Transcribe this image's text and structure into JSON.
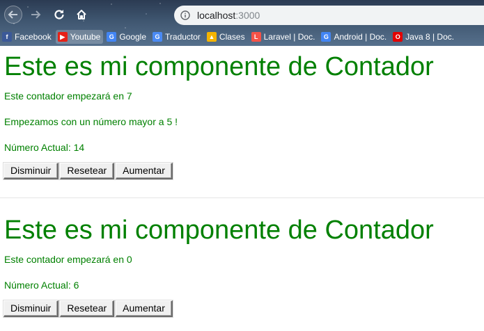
{
  "browser": {
    "url_host": "localhost",
    "url_port": ":3000",
    "bookmarks": [
      {
        "label": "Facebook",
        "icon": "facebook-icon",
        "color": "#3b5998",
        "glyph": "f"
      },
      {
        "label": "Youtube",
        "icon": "youtube-icon",
        "color": "#e62117",
        "glyph": "▶",
        "active": true
      },
      {
        "label": "Google",
        "icon": "google-icon",
        "color": "#4285f4",
        "glyph": "G"
      },
      {
        "label": "Traductor",
        "icon": "translate-icon",
        "color": "#4a8af4",
        "glyph": "G"
      },
      {
        "label": "Clases",
        "icon": "classroom-icon",
        "color": "#f4b400",
        "glyph": "▲"
      },
      {
        "label": "Laravel | Doc.",
        "icon": "laravel-icon",
        "color": "#f55247",
        "glyph": "L"
      },
      {
        "label": "Android | Doc.",
        "icon": "google-icon",
        "color": "#4285f4",
        "glyph": "G"
      },
      {
        "label": "Java 8 | Doc.",
        "icon": "oracle-icon",
        "color": "#e30000",
        "glyph": "O"
      }
    ]
  },
  "counters": [
    {
      "title": "Este es mi componente de Contador",
      "start_text": "Este contador empezará en 7",
      "extra_text": "Empezamos con un número mayor a 5 !",
      "current_text": "Número Actual: 14",
      "buttons": [
        "Disminuir",
        "Resetear",
        "Aumentar"
      ]
    },
    {
      "title": "Este es mi componente de Contador",
      "start_text": "Este contador empezará en 0",
      "current_text": "Número Actual: 6",
      "buttons": [
        "Disminuir",
        "Resetear",
        "Aumentar"
      ]
    }
  ],
  "colors": {
    "text_accent": "#008000"
  }
}
